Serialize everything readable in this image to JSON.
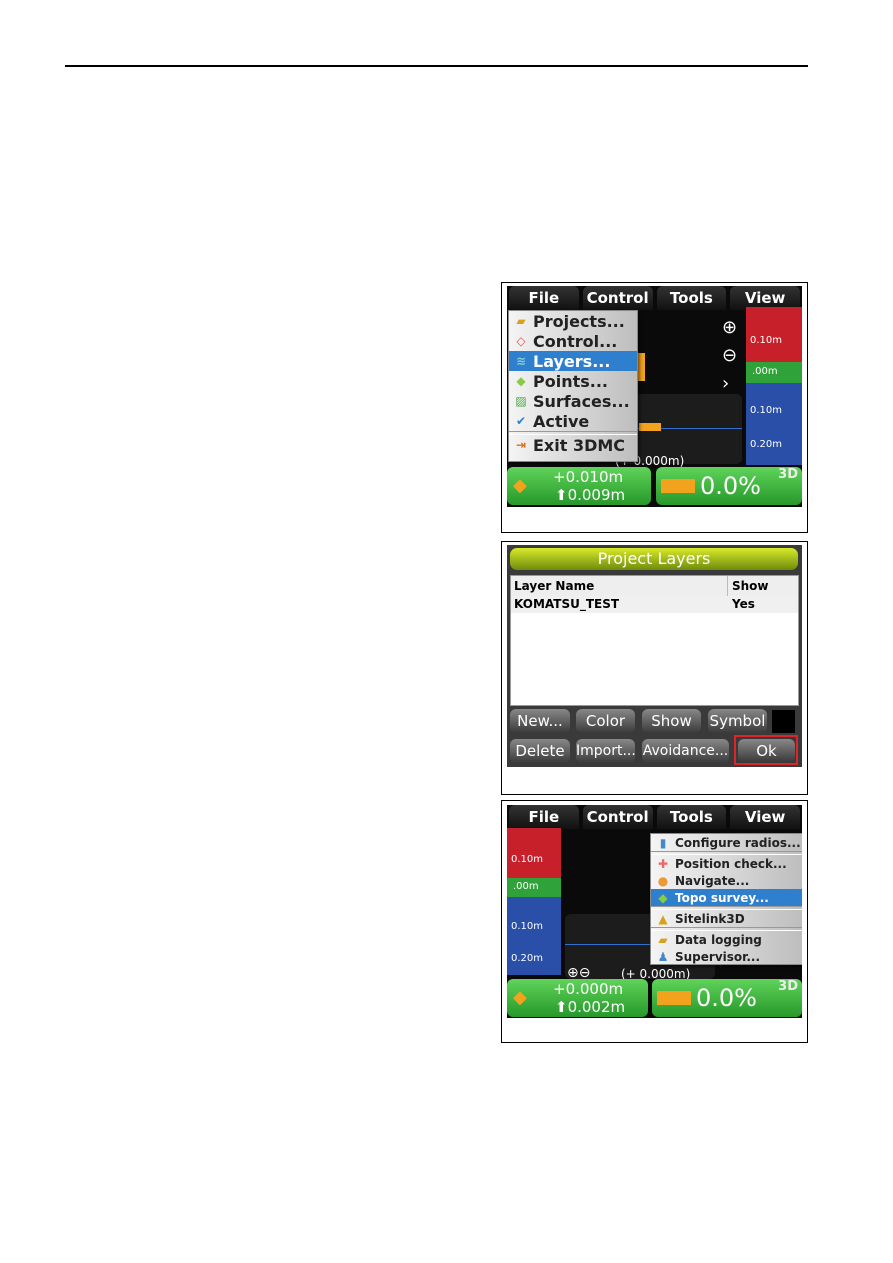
{
  "screen1": {
    "menubar": [
      "File",
      "Control",
      "Tools",
      "View"
    ],
    "file_menu": [
      {
        "label": "Projects...",
        "icon": "folder-icon"
      },
      {
        "label": "Control...",
        "icon": "control-diamond-icon"
      },
      {
        "label": "Layers...",
        "icon": "layers-icon",
        "selected": true
      },
      {
        "label": "Points...",
        "icon": "points-icon"
      },
      {
        "label": "Surfaces...",
        "icon": "surfaces-icon"
      },
      {
        "label": "Active",
        "icon": "check-icon",
        "submenu": true
      },
      {
        "label": "Exit 3DMC",
        "icon": "exit-icon"
      }
    ],
    "ruler": [
      "0.10m",
      ".00m",
      "0.10m",
      "0.20m"
    ],
    "offset_text": "(+ 0.000m)",
    "status": {
      "cut": "+0.010m",
      "elev": "0.009m",
      "percent": "0.0%",
      "mode": "3D"
    }
  },
  "screen2": {
    "title": "Project Layers",
    "columns": [
      "Layer Name",
      "Show"
    ],
    "rows": [
      {
        "name": "KOMATSU_TEST",
        "show": "Yes"
      }
    ],
    "buttons_row1": [
      "New...",
      "Color",
      "Show",
      "Symbol"
    ],
    "buttons_row2": [
      "Delete",
      "Import...",
      "Avoidance...",
      "Ok"
    ],
    "highlight_color": "#d9252b"
  },
  "screen3": {
    "menubar": [
      "File",
      "Control",
      "Tools",
      "View"
    ],
    "tools_menu": [
      {
        "label": "Configure radios...",
        "icon": "radio-icon"
      },
      {
        "label": "Position check...",
        "icon": "position-check-icon"
      },
      {
        "label": "Navigate...",
        "icon": "navigate-icon"
      },
      {
        "label": "Topo survey...",
        "icon": "topo-icon",
        "selected": true
      },
      {
        "label": "Sitelink3D",
        "icon": "sitelink-icon",
        "submenu": true
      },
      {
        "label": "Data logging",
        "icon": "data-logging-icon",
        "submenu": true
      },
      {
        "label": "Supervisor...",
        "icon": "supervisor-icon"
      }
    ],
    "ruler": [
      "0.10m",
      ".00m",
      "0.10m",
      "0.20m"
    ],
    "offset_text": "(+ 0.000m)",
    "status": {
      "cut": "+0.000m",
      "elev": "0.002m",
      "percent": "0.0%",
      "mode": "3D"
    }
  }
}
